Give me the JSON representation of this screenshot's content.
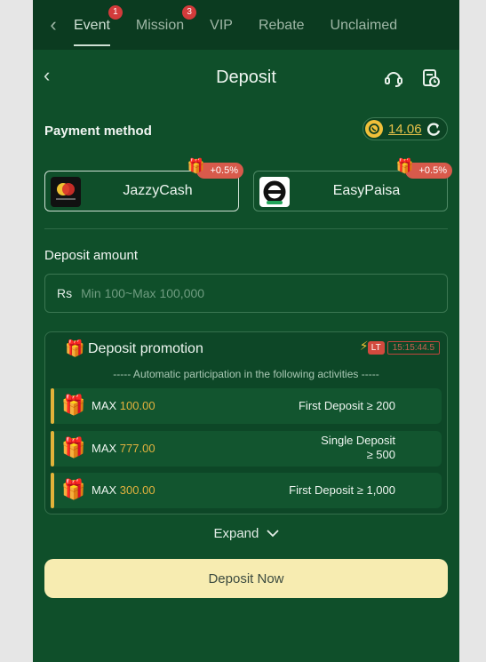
{
  "top_tabs": [
    {
      "label": "Event",
      "badge": "1"
    },
    {
      "label": "Mission",
      "badge": "3"
    },
    {
      "label": "VIP"
    },
    {
      "label": "Rebate"
    },
    {
      "label": "Unclaimed"
    }
  ],
  "header": {
    "title": "Deposit",
    "support_icon": "headset-icon",
    "history_icon": "record-clock-icon"
  },
  "payment": {
    "title": "Payment method",
    "balance": "14.06",
    "methods": [
      {
        "label": "JazzyCash",
        "bonus": "+0.5%",
        "selected": true
      },
      {
        "label": "EasyPaisa",
        "bonus": "+0.5%",
        "selected": false
      }
    ]
  },
  "amount": {
    "title": "Deposit amount",
    "currency": "Rs",
    "placeholder": "Min 100~Max 100,000"
  },
  "promotion": {
    "title": "Deposit promotion",
    "badge": "LT",
    "timer": "15:15:44.5",
    "subtitle": "----- Automatic participation in the following activities -----",
    "rows": [
      {
        "max_label": "MAX",
        "max_value": "100.00",
        "condition": "First Deposit ≥ 200"
      },
      {
        "max_label": "MAX",
        "max_value": "777.00",
        "condition_line1": "Single Deposit",
        "condition_line2": "≥ 500"
      },
      {
        "max_label": "MAX",
        "max_value": "300.00",
        "condition": "First Deposit ≥ 1,000"
      }
    ]
  },
  "expand_label": "Expand",
  "cta_label": "Deposit Now",
  "colors": {
    "bg": "#0f4f2a",
    "accent": "#f7ecb1",
    "gold": "#e2b23e",
    "badge": "#d85a4b"
  }
}
